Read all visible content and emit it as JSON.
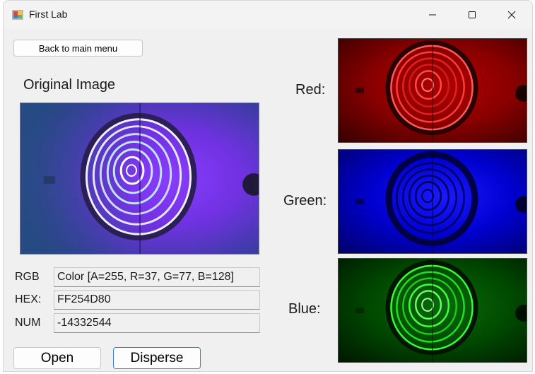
{
  "window": {
    "title": "First Lab"
  },
  "toolbar": {
    "back_label": "Back to main menu"
  },
  "original": {
    "label": "Original Image"
  },
  "channels": {
    "red_label": "Red:",
    "green_label": "Green:",
    "blue_label": "Blue:"
  },
  "fields": {
    "rgb_label": "RGB",
    "rgb_value": "Color [A=255, R=37, G=77, B=128]",
    "hex_label": "HEX:",
    "hex_value": "FF254D80",
    "num_label": "NUM",
    "num_value": "-14332544"
  },
  "actions": {
    "open_label": "Open",
    "disperse_label": "Disperse"
  },
  "icons": {
    "app": "app-icon",
    "minimize": "minimize-icon",
    "maximize": "maximize-icon",
    "close": "close-icon"
  },
  "colors": {
    "red_tint": "#8a0000",
    "green_tint": "#0000d0",
    "blue_tint": "#004a00",
    "accent_border": "#3a7fd6"
  }
}
